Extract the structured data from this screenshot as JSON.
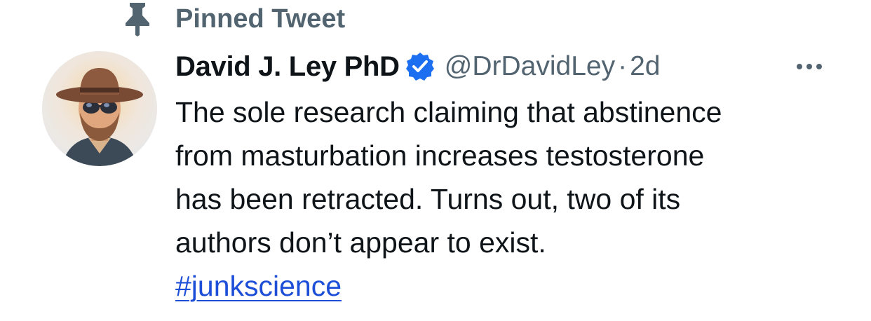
{
  "pinned": {
    "icon": "pin-icon",
    "label": "Pinned Tweet"
  },
  "tweet": {
    "avatar_icon": "avatar-illustration-man-with-hat-and-sunglasses",
    "author_name": "David J. Ley PhD",
    "verified_icon": "verified-badge-icon",
    "handle": "@DrDavidLey",
    "separator": "·",
    "age": "2d",
    "more_icon": "more-options-icon",
    "text_lines": [
      "The sole research claiming that abstinence",
      "from masturbation increases testosterone",
      "has been retracted. Turns out, two of its",
      "authors don’t appear to exist."
    ],
    "hashtag": "#junkscience"
  },
  "colors": {
    "text_primary": "#0f1419",
    "text_secondary": "#536471",
    "verified_blue": "#1d6ff2",
    "link": "#1d4ed8"
  }
}
